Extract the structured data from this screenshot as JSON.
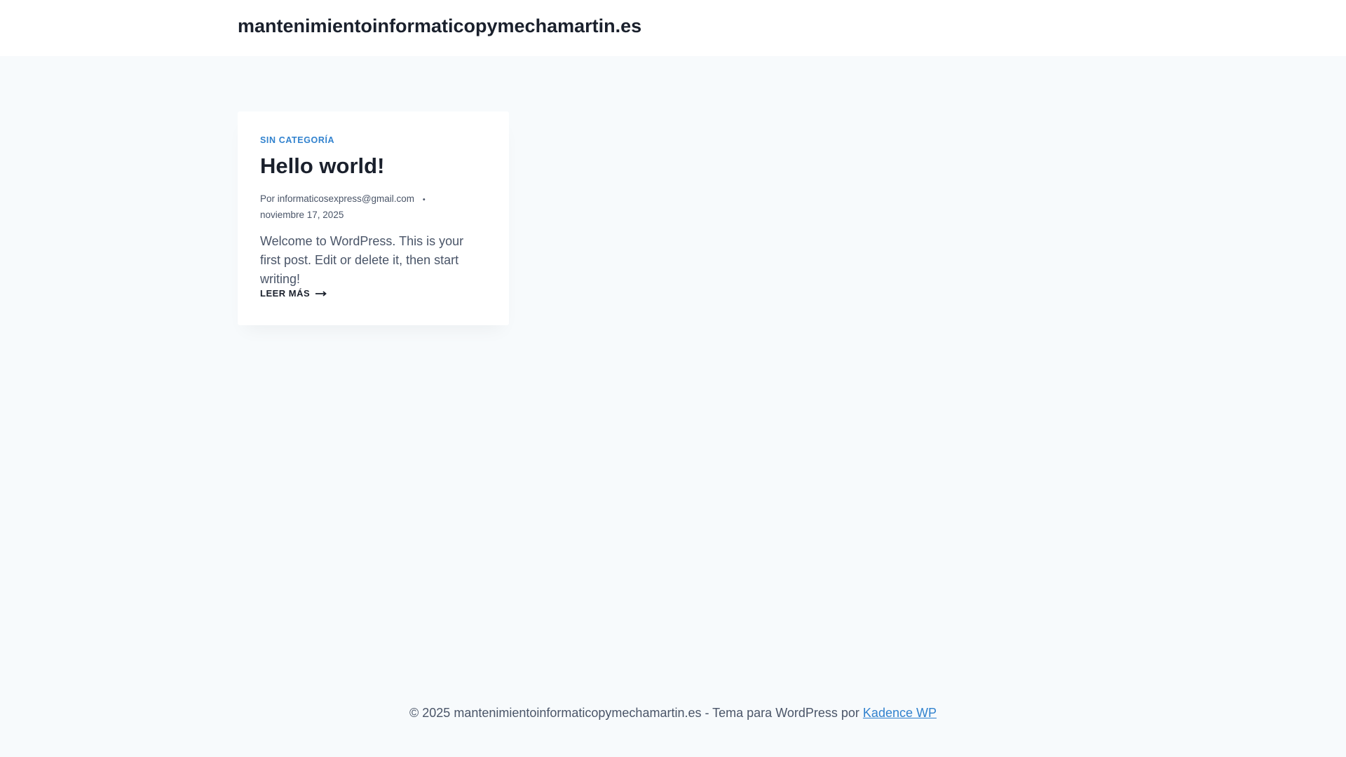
{
  "header": {
    "site_title": "mantenimientoinformaticopymechamartin.es"
  },
  "post": {
    "category": "SIN CATEGORÍA",
    "title": "Hello world!",
    "author_prefix": "Por",
    "author": "informaticosexpress@gmail.com",
    "separator": "•",
    "date": "noviembre 17, 2025",
    "excerpt": "Welcome to WordPress. This is your first post. Edit or delete it, then start writing!",
    "read_more": "LEER MÁS"
  },
  "footer": {
    "text": "© 2025 mantenimientoinformaticopymechamartin.es - Tema para WordPress por",
    "link": "Kadence WP"
  },
  "colors": {
    "accent": "#3182ce",
    "background": "#f7fafc",
    "heading": "#1a202c"
  }
}
